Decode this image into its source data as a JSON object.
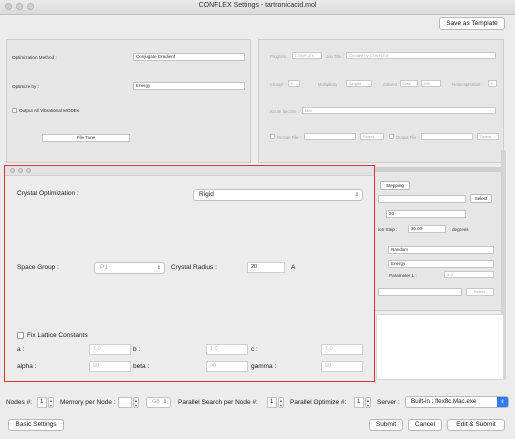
{
  "window": {
    "title": "CONFLEX Settings - tartronicacid.mol"
  },
  "toolbar": {
    "save_template": "Save as Template"
  },
  "left_panel": {
    "opt_method_label": "Optimization Method :",
    "opt_method_value": "Conjugate Gradient",
    "optimize_by_label": "Optimize by :",
    "optimize_by_value": "Energy",
    "output_vib_label": "Output All Vibrational MODEs",
    "file_tune_label": "File Tune"
  },
  "right_panel": {
    "program_label": "Program :",
    "program_value": "CONFLEX",
    "job_title_label": "Job Title :",
    "job_title_value": "Created by CONFLEX",
    "charge_label": "Charge :",
    "charge_value": "0",
    "multiplicity_label": "Multiplicity :",
    "multiplicity_value": "Singlet",
    "solvent_label": "Solvent :",
    "solvent_value": "Gas",
    "solvent_model": "GB",
    "nattempts_label": "NAttemptsStart :",
    "nattempts_value": "0",
    "route_label": "Route Section :",
    "route_value": "MM",
    "restart_label": "Restart File :",
    "select1": "Select...",
    "output_file_label": "Output File :",
    "select2": "Select..."
  },
  "search_panel": {
    "tab_label": "Stepping",
    "select_label": "Select",
    "field1_value": "20",
    "step_label": "ion Step :",
    "step_value": "30.00",
    "step_unit": "degrees",
    "random_value": "Random",
    "energy_value": "Energy",
    "param_label": "Parameter L :",
    "param_value": "3.0",
    "select3": "Select..."
  },
  "crystal": {
    "optimization_label": "Crystal Optimization :",
    "optimization_value": "Rigid",
    "space_group_label": "Space Group :",
    "space_group_value": "P1",
    "radius_label": "Crystal Radius :",
    "radius_value": "20",
    "radius_unit": "A",
    "fix_lattice_label": "Fix Lattice Constants",
    "a_label": "a :",
    "a_value": "1.0",
    "b_label": "b :",
    "b_value": "1.0",
    "c_label": "c :",
    "c_value": "1.0",
    "alpha_label": "alpha :",
    "alpha_value": "90",
    "beta_label": "beta :",
    "beta_value": "90",
    "gamma_label": "gamma :",
    "gamma_value": "90"
  },
  "bottom": {
    "nodes_label": "Nodes #:",
    "nodes_value": "1",
    "memory_label": "Memory per Node :",
    "memory_unit": "GB",
    "parallel_search_label": "Parallel Search per Node #:",
    "parallel_search_value": "1",
    "parallel_opt_label": "Parallel Optimize #:",
    "parallel_opt_value": "1",
    "server_label": "Server :",
    "server_value": "Built-in : flex8c.Mac.exe",
    "basic_settings": "Basic Settings",
    "submit": "Submit",
    "cancel": "Cancel",
    "edit_submit": "Edit & Submit"
  },
  "colors": {
    "highlight_border": "#d9332f",
    "accent": "#2e7bf6"
  }
}
